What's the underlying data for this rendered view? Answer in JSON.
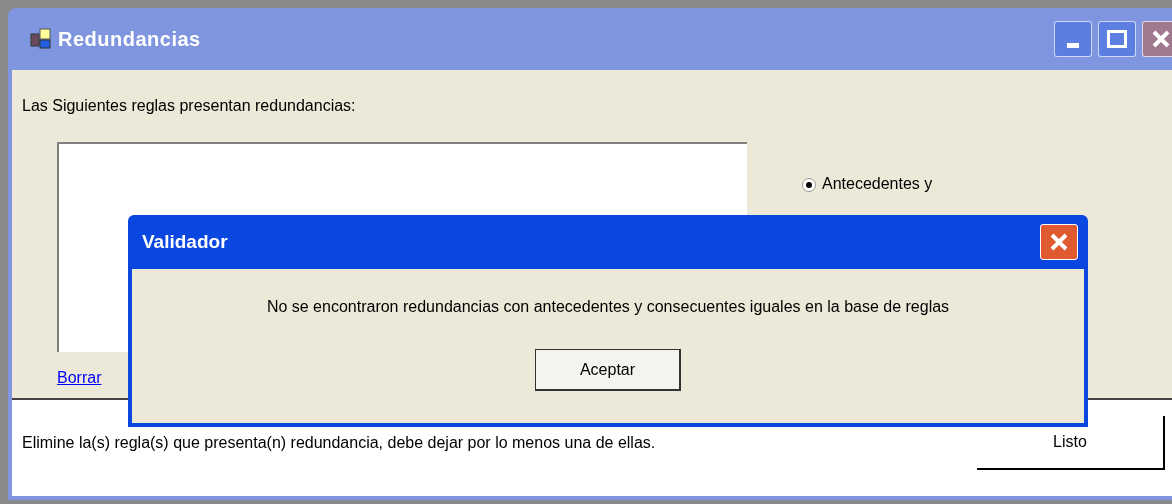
{
  "window": {
    "title": "Redundancias"
  },
  "heading": "Las Siguientes reglas presentan redundancias:",
  "radio": {
    "label": "Antecedentes y",
    "selected": true
  },
  "link": "Borrar",
  "footer": {
    "message": "Elimine la(s) regla(s) que presenta(n) redundancia, debe dejar por lo menos una de ellas.",
    "button": "Listo"
  },
  "dialog": {
    "title": "Validador",
    "message": "No se encontraron redundancias con antecedentes y consecuentes iguales en la base de reglas",
    "button": "Aceptar"
  }
}
